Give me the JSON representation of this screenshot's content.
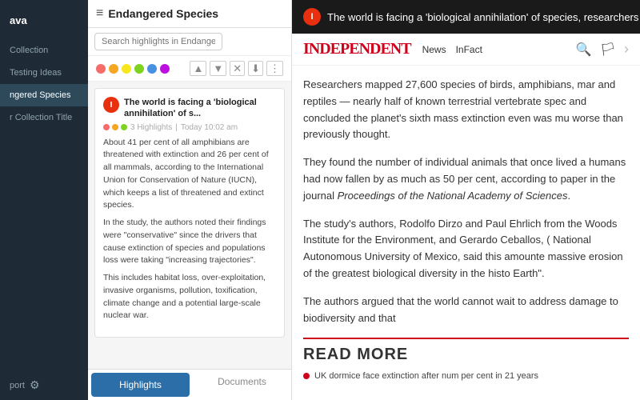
{
  "sidebar": {
    "logo": "ava",
    "items": [
      {
        "label": "Collection",
        "active": false
      },
      {
        "label": "Testing Ideas",
        "active": false
      },
      {
        "label": "ngered Species",
        "active": true
      },
      {
        "label": "r Collection Title",
        "active": false
      }
    ],
    "bottom": {
      "export_label": "port",
      "gear_label": "⚙"
    }
  },
  "middle": {
    "hamburger": "≡",
    "title": "Endangered Species",
    "search_placeholder": "Search highlights in Endangered Species...",
    "color_dots": [
      "#f76b6b",
      "#f5a623",
      "#f8e71c",
      "#7ed321",
      "#4a90e2",
      "#bd10e0"
    ],
    "toolbar": {
      "up": "▲",
      "down": "▼",
      "close": "✕",
      "download": "⬇",
      "more": "⋮"
    },
    "article": {
      "icon_letter": "I",
      "title": "The world is facing a 'biological annihilation' of s...",
      "meta_highlights": "3 Highlights",
      "meta_date": "Today 10:02 am",
      "highlight_dots": [
        {
          "color": "#f76b6b"
        },
        {
          "color": "#f5a623"
        },
        {
          "color": "#7ed321"
        }
      ],
      "paragraphs": [
        "About 41 per cent of all amphibians are threatened with extinction and 26 per cent of all mammals, according to the International Union for Conservation of Nature (IUCN), which keeps a list of threatened and extinct species.",
        "In the study, the authors noted their findings were \"conservative\" since the drivers that cause extinction of species and populations loss were taking \"increasing trajectories\".",
        "This includes habitat loss, over-exploitation, invasive organisms, pollution, toxification, climate change and a potential large-scale nuclear war."
      ]
    },
    "tabs": [
      {
        "label": "Highlights",
        "active": true
      },
      {
        "label": "Documents",
        "active": false
      }
    ]
  },
  "article_viewer": {
    "banner_text": "The world is facing a 'biological annihilation' of species, researchers w",
    "banner_icon": "I",
    "newspaper_logo": "INDEPENDENT",
    "nav_items": [
      "News",
      "InFact"
    ],
    "content_paragraphs": [
      "Researchers mapped 27,600 species of birds, amphibians, mar and reptiles — nearly half of known terrestrial vertebrate spec and concluded the planet's sixth mass extinction even was mu worse than previously thought.",
      "They found the number of individual animals that once lived a humans had now fallen by as much as 50 per cent, according to paper in the journal Proceedings of the National Academy of Sciences.",
      "The study's authors, Rodolfo Dirzo and Paul Ehrlich from the Woods Institute for the Environment, and Gerardo Ceballos, ( National Autonomous University of Mexico, said this amounte massive erosion of the greatest biological diversity in the histo Earth\".",
      "The authors argued that the world cannot wait to address damage to biodiversity and that"
    ],
    "read_more": {
      "label": "READ MORE",
      "item": "UK dormice face extinction after num per cent in 21 years"
    }
  }
}
